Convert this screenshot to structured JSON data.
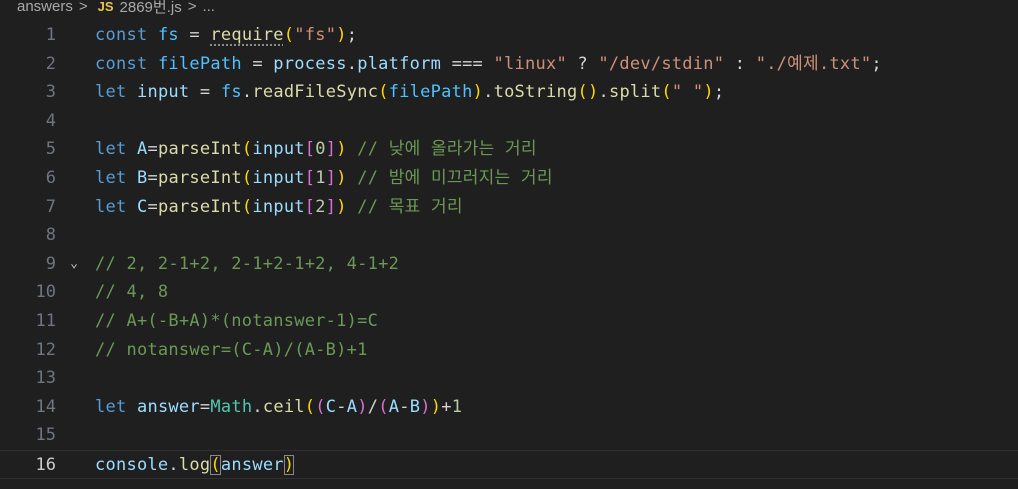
{
  "breadcrumb": {
    "folder": "answers",
    "separator": ">",
    "language_badge": "JS",
    "file": "2869번.js",
    "more": "..."
  },
  "editor": {
    "current_line": 16,
    "lines": [
      {
        "number": "1",
        "fold": "",
        "tokens": [
          {
            "t": "const",
            "c": "kw"
          },
          {
            "t": " ",
            "c": "plain"
          },
          {
            "t": "fs",
            "c": "const"
          },
          {
            "t": " = ",
            "c": "op"
          },
          {
            "t": "require",
            "c": "fn",
            "dotted": true
          },
          {
            "t": "(",
            "c": "p1"
          },
          {
            "t": "\"fs\"",
            "c": "str"
          },
          {
            "t": ")",
            "c": "p1"
          },
          {
            "t": ";",
            "c": "plain"
          }
        ]
      },
      {
        "number": "2",
        "fold": "",
        "tokens": [
          {
            "t": "const",
            "c": "kw"
          },
          {
            "t": " ",
            "c": "plain"
          },
          {
            "t": "filePath",
            "c": "const"
          },
          {
            "t": " = ",
            "c": "op"
          },
          {
            "t": "process",
            "c": "var"
          },
          {
            "t": ".",
            "c": "plain"
          },
          {
            "t": "platform",
            "c": "var"
          },
          {
            "t": " === ",
            "c": "op"
          },
          {
            "t": "\"linux\"",
            "c": "str"
          },
          {
            "t": " ? ",
            "c": "op"
          },
          {
            "t": "\"/dev/stdin\"",
            "c": "str"
          },
          {
            "t": " : ",
            "c": "op"
          },
          {
            "t": "\"./예제.txt\"",
            "c": "str"
          },
          {
            "t": ";",
            "c": "plain"
          }
        ]
      },
      {
        "number": "3",
        "fold": "",
        "tokens": [
          {
            "t": "let",
            "c": "kw"
          },
          {
            "t": " ",
            "c": "plain"
          },
          {
            "t": "input",
            "c": "var"
          },
          {
            "t": " = ",
            "c": "op"
          },
          {
            "t": "fs",
            "c": "const"
          },
          {
            "t": ".",
            "c": "plain"
          },
          {
            "t": "readFileSync",
            "c": "fn"
          },
          {
            "t": "(",
            "c": "p1"
          },
          {
            "t": "filePath",
            "c": "const"
          },
          {
            "t": ")",
            "c": "p1"
          },
          {
            "t": ".",
            "c": "plain"
          },
          {
            "t": "toString",
            "c": "fn"
          },
          {
            "t": "()",
            "c": "p1"
          },
          {
            "t": ".",
            "c": "plain"
          },
          {
            "t": "split",
            "c": "fn"
          },
          {
            "t": "(",
            "c": "p1"
          },
          {
            "t": "\" \"",
            "c": "str"
          },
          {
            "t": ")",
            "c": "p1"
          },
          {
            "t": ";",
            "c": "plain"
          }
        ]
      },
      {
        "number": "4",
        "fold": "",
        "tokens": []
      },
      {
        "number": "5",
        "fold": "",
        "tokens": [
          {
            "t": "let",
            "c": "kw"
          },
          {
            "t": " ",
            "c": "plain"
          },
          {
            "t": "A",
            "c": "var"
          },
          {
            "t": "=",
            "c": "op"
          },
          {
            "t": "parseInt",
            "c": "fn"
          },
          {
            "t": "(",
            "c": "p1"
          },
          {
            "t": "input",
            "c": "var"
          },
          {
            "t": "[",
            "c": "p2"
          },
          {
            "t": "0",
            "c": "num"
          },
          {
            "t": "]",
            "c": "p2"
          },
          {
            "t": ")",
            "c": "p1"
          },
          {
            "t": " // 낮에 올라가는 거리",
            "c": "cmt"
          }
        ]
      },
      {
        "number": "6",
        "fold": "",
        "tokens": [
          {
            "t": "let",
            "c": "kw"
          },
          {
            "t": " ",
            "c": "plain"
          },
          {
            "t": "B",
            "c": "var"
          },
          {
            "t": "=",
            "c": "op"
          },
          {
            "t": "parseInt",
            "c": "fn"
          },
          {
            "t": "(",
            "c": "p1"
          },
          {
            "t": "input",
            "c": "var"
          },
          {
            "t": "[",
            "c": "p2"
          },
          {
            "t": "1",
            "c": "num"
          },
          {
            "t": "]",
            "c": "p2"
          },
          {
            "t": ")",
            "c": "p1"
          },
          {
            "t": " // 밤에 미끄러지는 거리",
            "c": "cmt"
          }
        ]
      },
      {
        "number": "7",
        "fold": "",
        "tokens": [
          {
            "t": "let",
            "c": "kw"
          },
          {
            "t": " ",
            "c": "plain"
          },
          {
            "t": "C",
            "c": "var"
          },
          {
            "t": "=",
            "c": "op"
          },
          {
            "t": "parseInt",
            "c": "fn"
          },
          {
            "t": "(",
            "c": "p1"
          },
          {
            "t": "input",
            "c": "var"
          },
          {
            "t": "[",
            "c": "p2"
          },
          {
            "t": "2",
            "c": "num"
          },
          {
            "t": "]",
            "c": "p2"
          },
          {
            "t": ")",
            "c": "p1"
          },
          {
            "t": " // 목표 거리",
            "c": "cmt"
          }
        ]
      },
      {
        "number": "8",
        "fold": "",
        "tokens": []
      },
      {
        "number": "9",
        "fold": "⌄",
        "tokens": [
          {
            "t": "// 2, 2-1+2, 2-1+2-1+2, 4-1+2",
            "c": "cmt"
          }
        ]
      },
      {
        "number": "10",
        "fold": "",
        "tokens": [
          {
            "t": "// 4, 8",
            "c": "cmt"
          }
        ]
      },
      {
        "number": "11",
        "fold": "",
        "tokens": [
          {
            "t": "// A+(-B+A)*(notanswer-1)=C",
            "c": "cmt"
          }
        ]
      },
      {
        "number": "12",
        "fold": "",
        "tokens": [
          {
            "t": "// notanswer=(C-A)/(A-B)+1",
            "c": "cmt"
          }
        ]
      },
      {
        "number": "13",
        "fold": "",
        "tokens": []
      },
      {
        "number": "14",
        "fold": "",
        "tokens": [
          {
            "t": "let",
            "c": "kw"
          },
          {
            "t": " ",
            "c": "plain"
          },
          {
            "t": "answer",
            "c": "var"
          },
          {
            "t": "=",
            "c": "op"
          },
          {
            "t": "Math",
            "c": "cls"
          },
          {
            "t": ".",
            "c": "plain"
          },
          {
            "t": "ceil",
            "c": "fn"
          },
          {
            "t": "(",
            "c": "p1"
          },
          {
            "t": "(",
            "c": "p2"
          },
          {
            "t": "C",
            "c": "var"
          },
          {
            "t": "-",
            "c": "op"
          },
          {
            "t": "A",
            "c": "var"
          },
          {
            "t": ")",
            "c": "p2"
          },
          {
            "t": "/",
            "c": "op"
          },
          {
            "t": "(",
            "c": "p2"
          },
          {
            "t": "A",
            "c": "var"
          },
          {
            "t": "-",
            "c": "op"
          },
          {
            "t": "B",
            "c": "var"
          },
          {
            "t": ")",
            "c": "p2"
          },
          {
            "t": ")",
            "c": "p1"
          },
          {
            "t": "+",
            "c": "op"
          },
          {
            "t": "1",
            "c": "num"
          }
        ]
      },
      {
        "number": "15",
        "fold": "",
        "tokens": []
      },
      {
        "number": "16",
        "fold": "",
        "tokens": [
          {
            "t": "console",
            "c": "var"
          },
          {
            "t": ".",
            "c": "plain"
          },
          {
            "t": "log",
            "c": "fn"
          },
          {
            "t": "(",
            "c": "p1",
            "match": true
          },
          {
            "t": "answer",
            "c": "var"
          },
          {
            "t": ")",
            "c": "p1",
            "match": true
          }
        ]
      }
    ]
  }
}
